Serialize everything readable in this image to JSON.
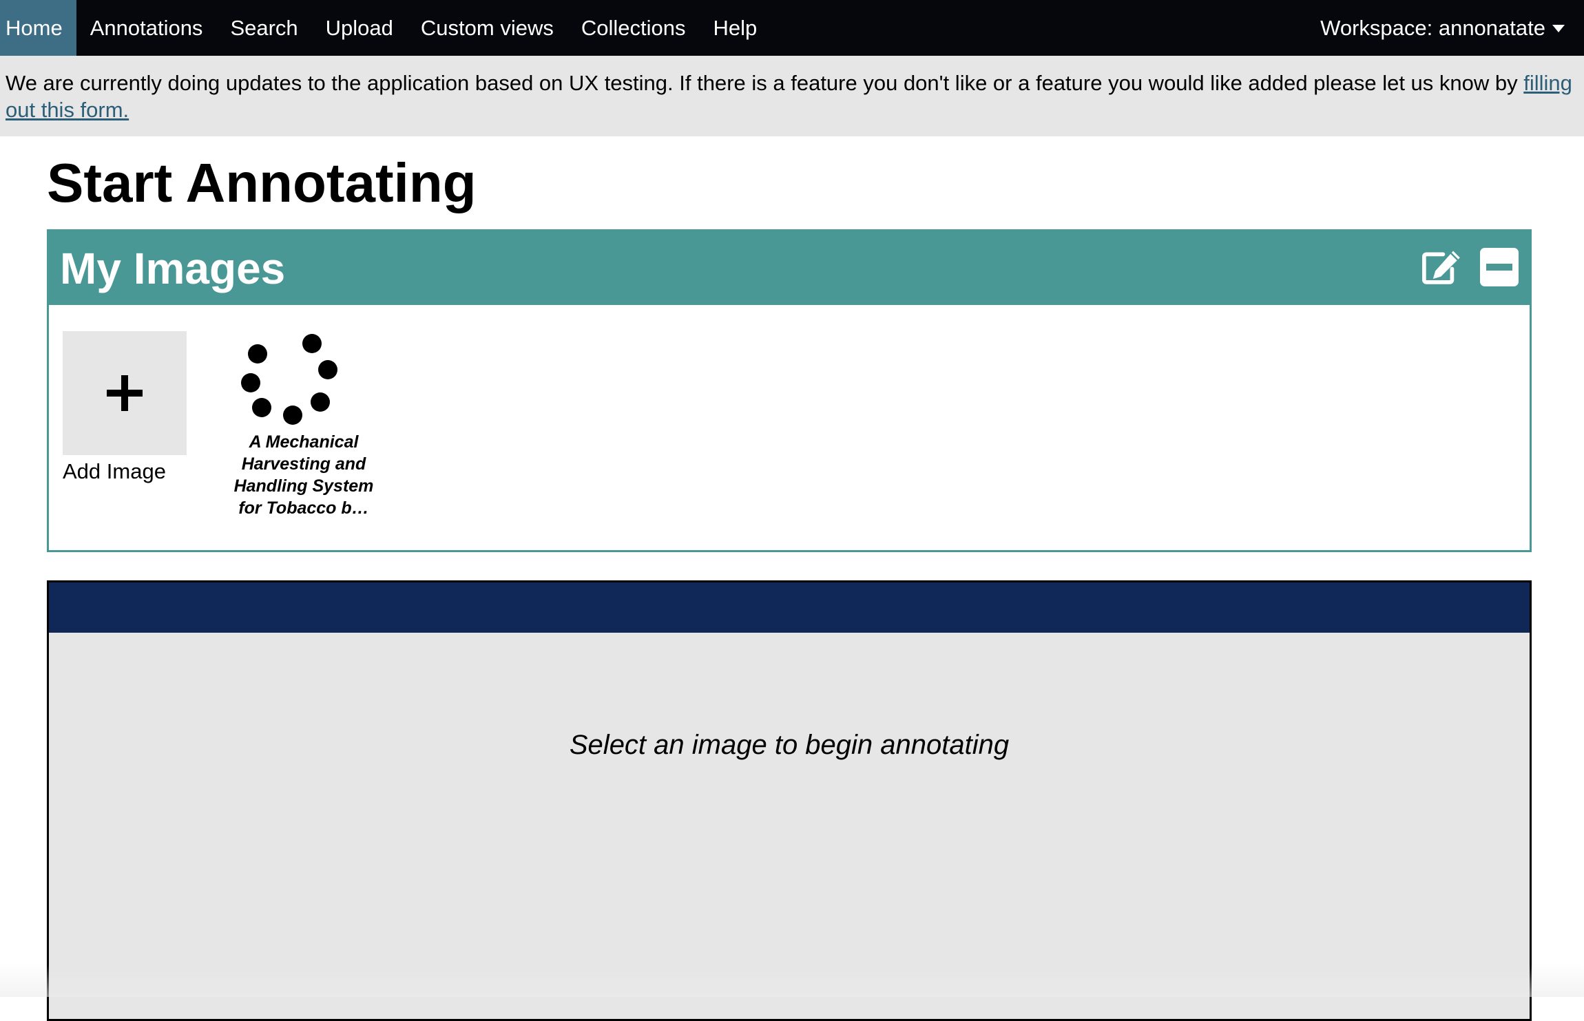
{
  "nav": {
    "items": [
      {
        "label": "Home",
        "active": true
      },
      {
        "label": "Annotations",
        "active": false
      },
      {
        "label": "Search",
        "active": false
      },
      {
        "label": "Upload",
        "active": false
      },
      {
        "label": "Custom views",
        "active": false
      },
      {
        "label": "Collections",
        "active": false
      },
      {
        "label": "Help",
        "active": false
      }
    ],
    "workspace_label": "Workspace: annonatate",
    "workspace_icon": "caret-down-icon",
    "background": "#05070d",
    "active_background": "#3d6e85"
  },
  "notice": {
    "text": "We are currently doing updates to the application based on UX testing. If there is a feature you don't like or a feature you would like added please let us know by ",
    "link_text": "filling out this form.",
    "background": "#e6e6e6"
  },
  "page": {
    "title": "Start Annotating"
  },
  "my_images": {
    "title": "My Images",
    "edit_icon": "edit-icon",
    "collapse_icon": "minus-square-icon",
    "accent": "#4a9896",
    "add_tile": {
      "icon": "plus-icon",
      "label": "Add Image"
    },
    "images": [
      {
        "thumbnail_icon": "loading-spinner-icon",
        "caption": "A Mechanical Harvesting and Handling System for Tobacco b…"
      }
    ]
  },
  "viewer": {
    "header_color": "#0f2857",
    "background": "#e6e6e6",
    "message": "Select an image to begin annotating"
  }
}
